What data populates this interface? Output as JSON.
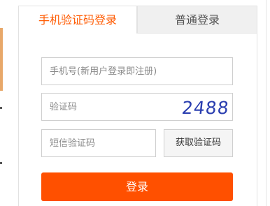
{
  "tabs": {
    "phone_login": "手机验证码登录",
    "normal_login": "普通登录"
  },
  "form": {
    "phone_placeholder": "手机号(新用户登录即注册)",
    "captcha_placeholder": "验证码",
    "captcha_text": "2488",
    "sms_placeholder": "短信验证码",
    "sms_button": "获取验证码",
    "login_button": "登录"
  },
  "colors": {
    "accent": "#ff5a00",
    "login_button": "#ff5000",
    "captcha_ink": "#2b3fb0"
  }
}
